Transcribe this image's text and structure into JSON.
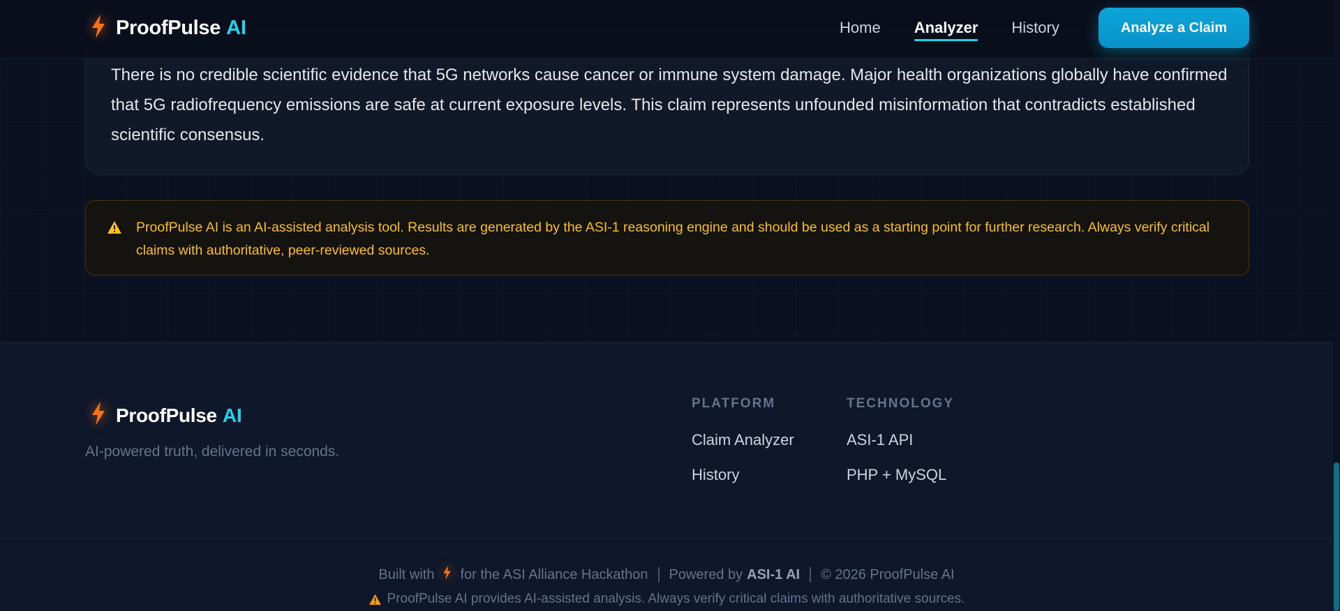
{
  "nav": {
    "brand_name": "ProofPulse",
    "brand_ai": "AI",
    "links": [
      {
        "label": "Home",
        "active": false
      },
      {
        "label": "Analyzer",
        "active": true
      },
      {
        "label": "History",
        "active": false
      }
    ],
    "cta_label": "Analyze a Claim"
  },
  "summary": {
    "text": "There is no credible scientific evidence that 5G networks cause cancer or immune system damage. Major health organizations globally have confirmed that 5G radiofrequency emissions are safe at current exposure levels. This claim represents unfounded misinformation that contradicts established scientific consensus."
  },
  "disclaimer": {
    "icon": "warning-icon",
    "text": "ProofPulse AI is an AI-assisted analysis tool. Results are generated by the ASI-1 reasoning engine and should be used as a starting point for further research. Always verify critical claims with authoritative, peer-reviewed sources."
  },
  "footer": {
    "brand_name": "ProofPulse",
    "brand_ai": "AI",
    "tagline": "AI-powered truth, delivered in seconds.",
    "columns": [
      {
        "heading": "PLATFORM",
        "links": [
          "Claim Analyzer",
          "History"
        ]
      },
      {
        "heading": "TECHNOLOGY",
        "links": [
          "ASI-1 API",
          "PHP + MySQL"
        ]
      }
    ],
    "bottom": {
      "built_with": "Built with",
      "hackathon": "for the ASI Alliance Hackathon",
      "powered_by": "Powered by",
      "powered_by_strong": "ASI-1 AI",
      "copyright": "© 2026 ProofPulse AI"
    },
    "note": "ProofPulse AI provides AI-assisted analysis. Always verify critical claims with authoritative sources."
  },
  "colors": {
    "accent_cyan": "#22d3ee",
    "bolt_orange": "#f97316",
    "warning_amber": "#fbbf24",
    "background": "#0a0f1c"
  }
}
